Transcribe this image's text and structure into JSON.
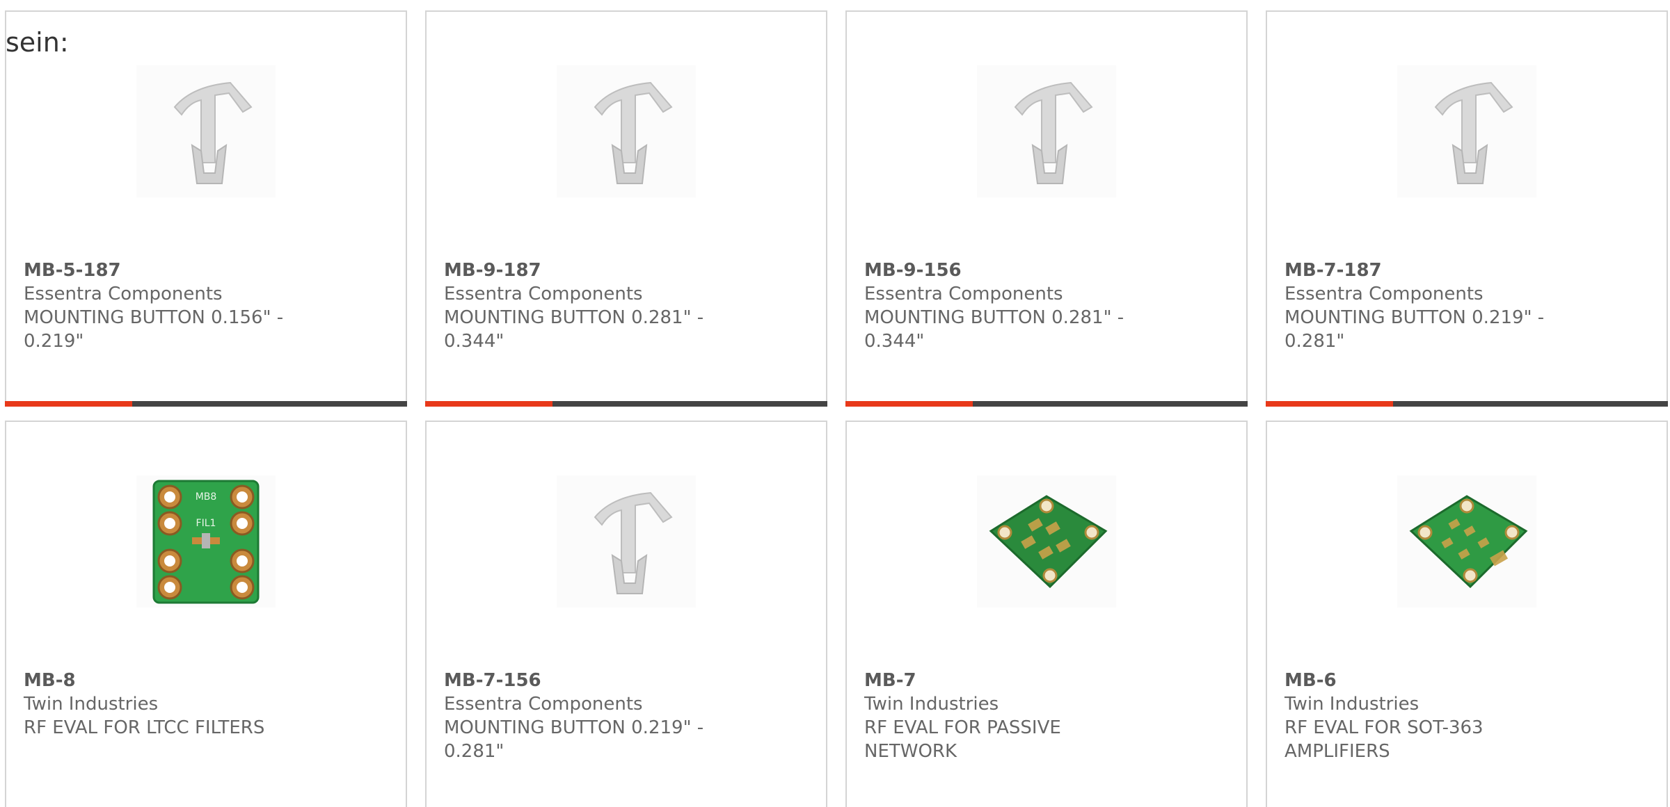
{
  "lead_text": "sein:",
  "colors": {
    "card_border": "#d4d4d4",
    "bar_dark": "#444444",
    "bar_accent": "#e8391a",
    "text": "#666666"
  },
  "products": [
    {
      "part_number": "MB-5-187",
      "manufacturer": "Essentra Components",
      "description": "MOUNTING BUTTON 0.156\" - 0.219\"",
      "image_icon": "mounting-button-icon"
    },
    {
      "part_number": "MB-9-187",
      "manufacturer": "Essentra Components",
      "description": "MOUNTING BUTTON 0.281\" - 0.344\"",
      "image_icon": "mounting-button-icon"
    },
    {
      "part_number": "MB-9-156",
      "manufacturer": "Essentra Components",
      "description": "MOUNTING BUTTON 0.281\" - 0.344\"",
      "image_icon": "mounting-button-icon"
    },
    {
      "part_number": "MB-7-187",
      "manufacturer": "Essentra Components",
      "description": "MOUNTING BUTTON 0.219\" - 0.281\"",
      "image_icon": "mounting-button-icon"
    },
    {
      "part_number": "MB-8",
      "manufacturer": "Twin Industries",
      "description": "RF EVAL FOR LTCC FILTERS",
      "image_icon": "pcb-board-icon",
      "board_label_1": "MB8",
      "board_label_2": "FIL1"
    },
    {
      "part_number": "MB-7-156",
      "manufacturer": "Essentra Components",
      "description": "MOUNTING BUTTON 0.219\" - 0.281\"",
      "image_icon": "mounting-button-icon"
    },
    {
      "part_number": "MB-7",
      "manufacturer": "Twin Industries",
      "description": "RF EVAL FOR PASSIVE NETWORK",
      "image_icon": "pcb-board-angled-icon"
    },
    {
      "part_number": "MB-6",
      "manufacturer": "Twin Industries",
      "description": "RF EVAL FOR SOT-363 AMPLIFIERS",
      "image_icon": "pcb-board-angled-icon"
    }
  ]
}
